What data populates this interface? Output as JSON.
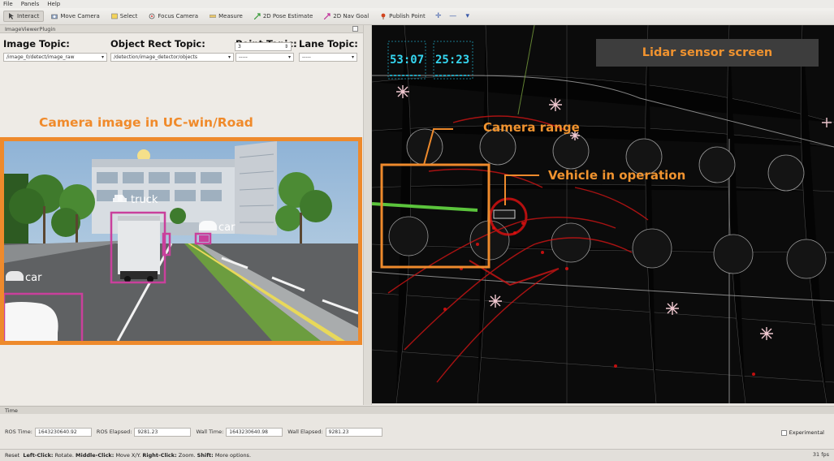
{
  "menu": [
    "File",
    "Panels",
    "Help"
  ],
  "toolbar": [
    {
      "label": "Interact",
      "icon": "cursor-icon",
      "active": true
    },
    {
      "label": "Move Camera",
      "icon": "camera-move-icon",
      "active": false
    },
    {
      "label": "Select",
      "icon": "select-box-icon",
      "active": false
    },
    {
      "label": "Focus Camera",
      "icon": "focus-target-icon",
      "active": false
    },
    {
      "label": "Measure",
      "icon": "ruler-icon",
      "active": false
    },
    {
      "label": "2D Pose Estimate",
      "icon": "pose-arrow-icon",
      "active": false
    },
    {
      "label": "2D Nav Goal",
      "icon": "nav-goal-icon",
      "active": false
    },
    {
      "label": "Publish Point",
      "icon": "map-pin-icon",
      "active": false
    }
  ],
  "panel": {
    "title": "ImageViewerPlugin"
  },
  "topics": {
    "image": {
      "label": "Image Topic:",
      "value": "/image_0/detect/image_raw"
    },
    "rect": {
      "label": "Object Rect Topic:",
      "value": "/detection/image_detector/objects"
    },
    "point": {
      "label": "Point Topic:",
      "value": "-----",
      "spin_value": "3"
    },
    "lane": {
      "label": "Lane Topic:",
      "value": "-----"
    }
  },
  "annotations": {
    "camera_image": "Camera image in UC-win/Road",
    "lidar_screen": "Lidar sensor screen",
    "camera_range": "Camera range",
    "vehicle": "Vehicle in operation"
  },
  "detections": [
    {
      "label": "truck"
    },
    {
      "label": "car"
    },
    {
      "label": "car"
    }
  ],
  "lidar_overlay": {
    "time1": "53:07",
    "time2": "25:23"
  },
  "time_panel": {
    "title": "Time",
    "ros_time_label": "ROS Time:",
    "ros_time": "1643230640.92",
    "ros_elapsed_label": "ROS Elapsed:",
    "ros_elapsed": "9281.23",
    "wall_time_label": "Wall Time:",
    "wall_time": "1643230640.98",
    "wall_elapsed_label": "Wall Elapsed:",
    "wall_elapsed": "9281.23",
    "experimental": "Experimental"
  },
  "status": {
    "reset": "Reset",
    "left_click": "Left-Click:",
    "left_click_desc": "Rotate.",
    "middle_click": "Middle-Click:",
    "middle_click_desc": "Move X/Y.",
    "right_click": "Right-Click:",
    "right_click_desc": "Zoom.",
    "shift": "Shift:",
    "shift_desc": "More options.",
    "fps": "31 fps"
  },
  "colors": {
    "annotation": "#f0932f",
    "camera_border": "#ee8a2c",
    "bbox": "#c9409c",
    "lidar_points": "#e01010"
  }
}
